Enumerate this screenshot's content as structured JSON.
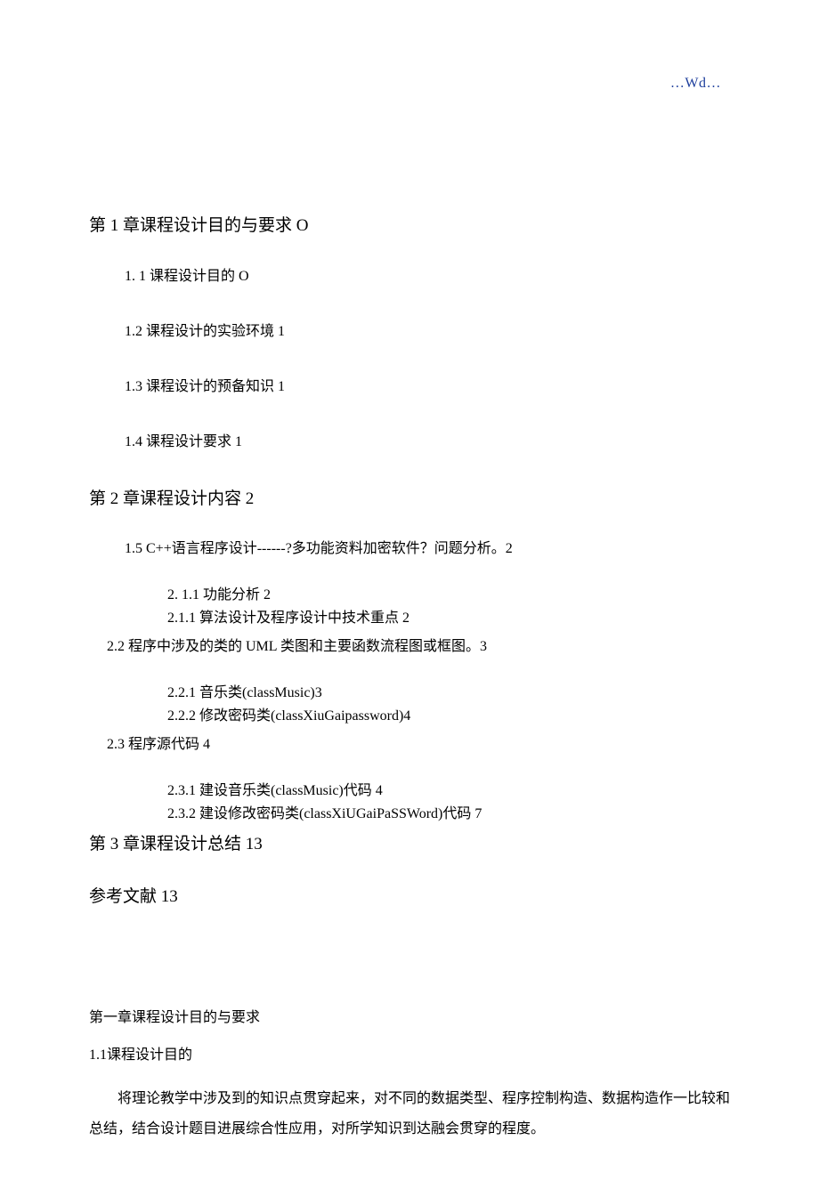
{
  "header": {
    "mark": "…Wd…"
  },
  "toc": {
    "ch1": {
      "title": "第 1 章课程设计目的与要求 O",
      "items": [
        "1.  1 课程设计目的 O",
        "1.2   课程设计的实验环境 1",
        "1.3   课程设计的预备知识 1",
        "1.4   课程设计要求 1"
      ]
    },
    "ch2": {
      "title": "第 2 章课程设计内容 2",
      "sec1_5": "1.5   C++语言程序设计------?多功能资料加密软件？问题分析。2",
      "sec2_1_1": "2.  1.1 功能分析 2",
      "sec2_1_1b": "2.1.1 算法设计及程序设计中技术重点 2",
      "sec2_2": "2.2 程序中涉及的类的 UML 类图和主要函数流程图或框图。3",
      "sec2_2_1": "2.2.1 音乐类(classMusic)3",
      "sec2_2_2": "2.2.2 修改密码类(classXiuGaipassword)4",
      "sec2_3": "2.3 程序源代码 4",
      "sec2_3_1": "2.3.1 建设音乐类(classMusic)代码 4",
      "sec2_3_2": "2.3.2 建设修改密码类(classXiUGaiPaSSWord)代码 7"
    },
    "ch3": {
      "title": "第 3 章课程设计总结 13"
    },
    "refs": {
      "title": "参考文献 13"
    }
  },
  "body": {
    "h1": "第一章课程设计目的与要求",
    "h2": "1.1课程设计目的",
    "para": "将理论教学中涉及到的知识点贯穿起来，对不同的数据类型、程序控制构造、数据构造作一比较和总结，结合设计题目进展综合性应用，对所学知识到达融会贯穿的程度。"
  }
}
